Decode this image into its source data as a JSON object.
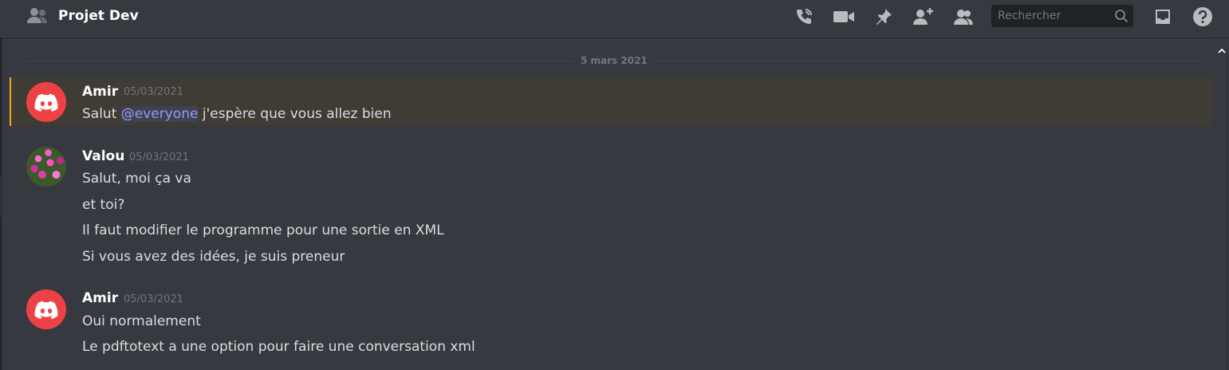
{
  "header": {
    "title": "Projet Dev",
    "search_placeholder": "Rechercher",
    "icons": [
      "people-group-icon",
      "call-icon",
      "video-icon",
      "pin-icon",
      "add-member-icon",
      "members-icon",
      "search-icon",
      "inbox-icon",
      "help-icon"
    ]
  },
  "divider": {
    "date": "5 mars 2021"
  },
  "messages": [
    {
      "author": "Amir",
      "timestamp": "05/03/2021",
      "avatar": "discord-logo",
      "highlighted": true,
      "lines": [
        {
          "prefix": "Salut ",
          "mention": "@everyone",
          "suffix": " j'espère que vous allez bien"
        }
      ]
    },
    {
      "author": "Valou",
      "timestamp": "05/03/2021",
      "avatar": "pink-flowers-photo",
      "lines": [
        "Salut, moi ça va",
        "et toi?",
        "Il faut modifier le programme pour une sortie en XML",
        "Si vous avez des idées, je suis preneur"
      ]
    },
    {
      "author": "Amir",
      "timestamp": "05/03/2021",
      "avatar": "discord-logo",
      "lines": [
        "Oui normalement",
        "Le pdftotext a une option pour faire une conversation xml"
      ]
    }
  ],
  "colors": {
    "background": "#36393f",
    "mention_highlight_bar": "#faa61a",
    "mention_text": "#8e9cf5",
    "avatar_red": "#ed4245"
  }
}
